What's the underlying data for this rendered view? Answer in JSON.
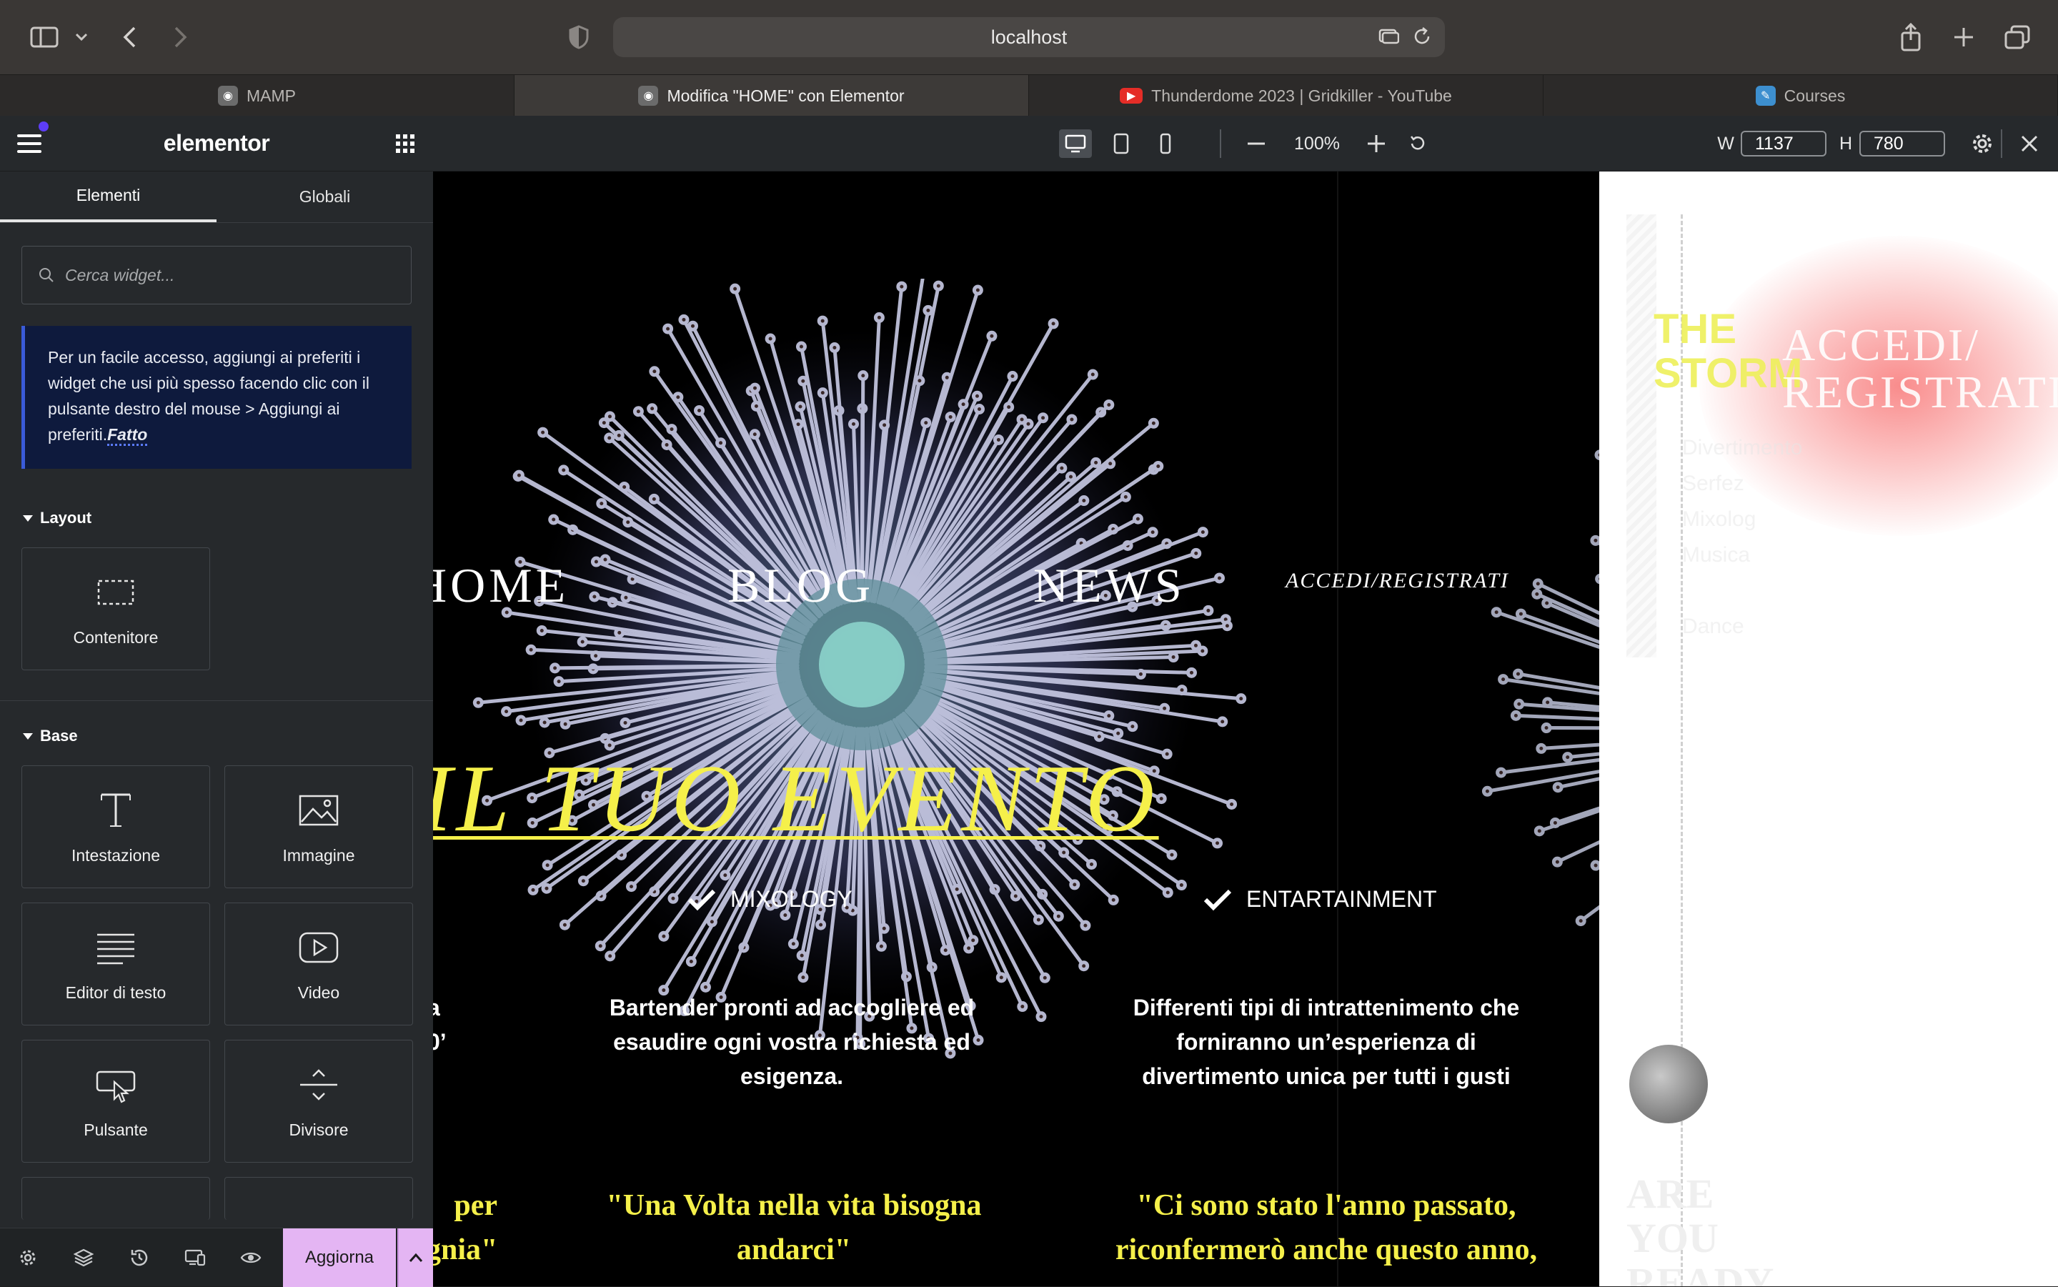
{
  "browser": {
    "url": "localhost",
    "tabs": [
      {
        "label": "MAMP",
        "active": false
      },
      {
        "label": "Modifica \"HOME\" con Elementor",
        "active": true
      },
      {
        "label": "Thunderdome 2023 | Gridkiller - YouTube",
        "active": false
      },
      {
        "label": "Courses",
        "active": false
      }
    ]
  },
  "panel": {
    "brand": "elementor",
    "tabs": [
      "Elementi",
      "Globali"
    ],
    "search_placeholder": "Cerca widget...",
    "tip_text": "Per un facile accesso, aggiungi ai preferiti i widget che usi più spesso facendo clic con il pulsante destro del mouse > Aggiungi ai preferiti.",
    "tip_link": "Fatto",
    "layout_title": "Layout",
    "layout_widgets": [
      "Contenitore"
    ],
    "base_title": "Base",
    "base_widgets": [
      "Intestazione",
      "Immagine",
      "Editor di testo",
      "Video",
      "Pulsante",
      "Divisore"
    ],
    "update_label": "Aggiorna"
  },
  "responsive": {
    "zoom": "100%",
    "width_label": "W",
    "width_value": "1137",
    "height_label": "H",
    "height_value": "780"
  },
  "site": {
    "nav": [
      "HOME",
      "BLOG",
      "NEWS",
      "ACCEDI/REGISTRATI"
    ],
    "hero": "IL TUO EVENTO",
    "features": [
      {
        "label": "MIXOLOGY",
        "text": "Bartender pronti ad accogliere ed esaudire ogni vostra richiesta ed esigenza."
      },
      {
        "label": "ENTARTAINMENT",
        "text": "Differenti tipi di intrattenimento che forniranno un’esperienza di divertimento unica per tutti i gusti"
      }
    ],
    "left_cut_text": [
      "a",
      "0’"
    ],
    "quotes": [
      "per\ngnia\"",
      "\"Una Volta nella vita bisogna andarci\"",
      "\"Ci sono stato l'anno passato, riconfermerò anche questo anno,"
    ]
  },
  "preview_mobile": {
    "title": "THE STORM",
    "accedi": "ACCEDI/ REGISTRATI",
    "menu": [
      "Divertimento",
      "Serfez",
      "Mixolog",
      "Musica",
      "",
      "Dance"
    ],
    "bottom_text": "ARE YOU READY"
  },
  "colors": {
    "accent_yellow": "#f5f04a",
    "update_button": "#e4b5f3",
    "panel_bg": "#26292c",
    "tip_bg": "#0e1a3d"
  }
}
